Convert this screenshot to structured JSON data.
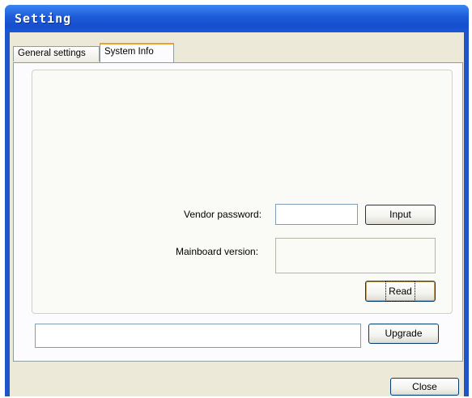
{
  "window": {
    "title": "Setting"
  },
  "tabs": [
    {
      "label": "General settings"
    },
    {
      "label": "System Info"
    }
  ],
  "system_info": {
    "vendor_password": {
      "label": "Vendor password:",
      "value": ""
    },
    "input_button": "Input",
    "mainboard_version": {
      "label": "Mainboard version:",
      "value": ""
    },
    "read_button": "Read",
    "upgrade_path": {
      "value": ""
    },
    "upgrade_button": "Upgrade"
  },
  "footer": {
    "close_button": "Close"
  },
  "colors": {
    "titlebar": "#1f55c9",
    "dialog_bg": "#ece9d8",
    "active_tab_accent": "#f0a030"
  }
}
